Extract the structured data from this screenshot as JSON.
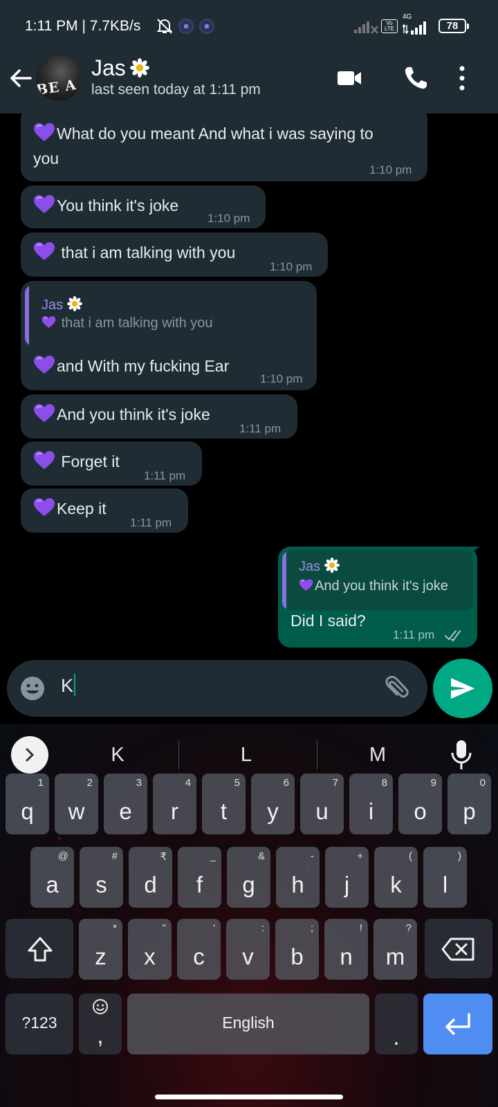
{
  "status_bar": {
    "time": "1:11 PM | 7.7KB/s",
    "network": "4G",
    "volte": "Vo LTE",
    "battery": "78"
  },
  "header": {
    "name": "Jas",
    "last_seen": "last seen today at 1:11 pm",
    "avatar_text": "BE A"
  },
  "messages": [
    {
      "line1": "What do you meant And what i was saying to",
      "line2": "you",
      "time": "1:10 pm"
    },
    {
      "text": "You think it's joke",
      "time": "1:10 pm"
    },
    {
      "text": " that i am talking with you",
      "time": "1:10 pm"
    },
    {
      "quote_name": "Jas",
      "quote_text": "that i am talking with you",
      "text": "and With my fucking Ear",
      "time": "1:10 pm"
    },
    {
      "text": "And you think it's joke",
      "time": "1:11 pm"
    },
    {
      "text": " Forget it",
      "time": "1:11 pm"
    },
    {
      "text": "Keep it",
      "time": "1:11 pm"
    },
    {
      "quote_name": "Jas",
      "quote_text": "And you think it's joke",
      "text": "Did I said?",
      "time": "1:11 pm",
      "outgoing": true,
      "read": true
    }
  ],
  "composer": {
    "text": "K"
  },
  "keyboard": {
    "suggestions": [
      "K",
      "L",
      "M"
    ],
    "row1": [
      {
        "k": "q",
        "h": "1"
      },
      {
        "k": "w",
        "h": "2"
      },
      {
        "k": "e",
        "h": "3"
      },
      {
        "k": "r",
        "h": "4"
      },
      {
        "k": "t",
        "h": "5"
      },
      {
        "k": "y",
        "h": "6"
      },
      {
        "k": "u",
        "h": "7"
      },
      {
        "k": "i",
        "h": "8"
      },
      {
        "k": "o",
        "h": "9"
      },
      {
        "k": "p",
        "h": "0"
      }
    ],
    "row2": [
      {
        "k": "a",
        "h": "@"
      },
      {
        "k": "s",
        "h": "#"
      },
      {
        "k": "d",
        "h": "₹"
      },
      {
        "k": "f",
        "h": "_"
      },
      {
        "k": "g",
        "h": "&"
      },
      {
        "k": "h",
        "h": "-"
      },
      {
        "k": "j",
        "h": "+"
      },
      {
        "k": "k",
        "h": "("
      },
      {
        "k": "l",
        "h": ")"
      }
    ],
    "row3": [
      {
        "k": "z",
        "h": "*"
      },
      {
        "k": "x",
        "h": "\""
      },
      {
        "k": "c",
        "h": "'"
      },
      {
        "k": "v",
        "h": ":"
      },
      {
        "k": "b",
        "h": ";"
      },
      {
        "k": "n",
        "h": "!"
      },
      {
        "k": "m",
        "h": "?"
      }
    ],
    "symbols": "?123",
    "comma": ",",
    "space": "English",
    "period": "."
  },
  "colors": {
    "header_bg": "#1f2c34",
    "incoming_bubble": "#1f2c34",
    "outgoing_bubble": "#005c4b",
    "accent": "#00a884",
    "quote_accent": "#8b6fe0",
    "enter_key": "#4f8df2"
  },
  "icons": [
    "back-arrow-icon",
    "video-call-icon",
    "voice-call-icon",
    "more-options-icon",
    "emoji-icon",
    "attach-icon",
    "send-icon",
    "mic-icon",
    "shift-icon",
    "backspace-icon",
    "enter-icon",
    "heart-emoji",
    "daisy-emoji",
    "read-ticks-icon"
  ]
}
